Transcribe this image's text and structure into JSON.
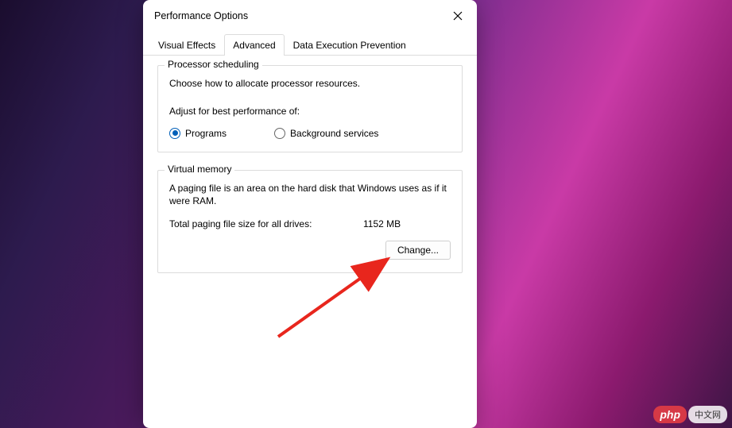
{
  "window": {
    "title": "Performance Options"
  },
  "tabs": {
    "visual_effects": "Visual Effects",
    "advanced": "Advanced",
    "dep": "Data Execution Prevention"
  },
  "processor": {
    "legend": "Processor scheduling",
    "description": "Choose how to allocate processor resources.",
    "adjust_label": "Adjust for best performance of:",
    "programs": "Programs",
    "background": "Background services"
  },
  "virtual_memory": {
    "legend": "Virtual memory",
    "description": "A paging file is an area on the hard disk that Windows uses as if it were RAM.",
    "total_label": "Total paging file size for all drives:",
    "total_value": "1152 MB",
    "change_button": "Change..."
  },
  "watermark": {
    "logo": "php",
    "text": "中文网"
  }
}
